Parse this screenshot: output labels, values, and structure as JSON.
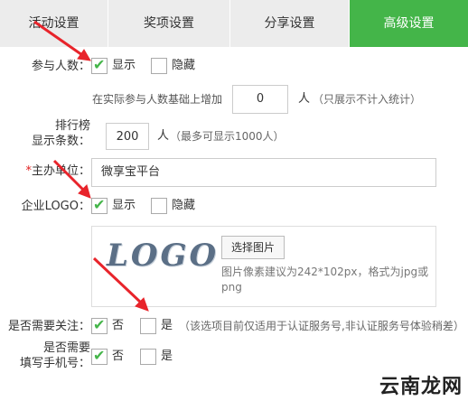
{
  "tabs": [
    {
      "label": "活动设置"
    },
    {
      "label": "奖项设置"
    },
    {
      "label": "分享设置"
    },
    {
      "label": "高级设置"
    }
  ],
  "participants": {
    "label": "参与人数：",
    "show": "显示",
    "hide": "隐藏",
    "increase_prefix": "在实际参与人数基础上增加",
    "increase_value": "0",
    "unit": "人",
    "increase_note": "（只展示不计入统计）"
  },
  "leaderboard": {
    "label_line1": "排行榜",
    "label_line2": "显示条数：",
    "value": "200",
    "unit": "人",
    "note": "（最多可显示1000人）"
  },
  "organizer": {
    "required_mark": "*",
    "label": "主办单位：",
    "value": "微享宝平台"
  },
  "logo": {
    "label": "企业LOGO：",
    "show": "显示",
    "hide": "隐藏",
    "preview_text": "LOGO",
    "pick_button": "选择图片",
    "hint": "图片像素建议为242*102px，格式为jpg或png"
  },
  "follow": {
    "label": "是否需要关注：",
    "no": "否",
    "yes": "是",
    "note": "（该选项目前仅适用于认证服务号,非认证服务号体验稍差）"
  },
  "phone": {
    "label_line1": "是否需要",
    "label_line2": "填写手机号：",
    "no": "否",
    "yes": "是"
  },
  "watermark": "云南龙网",
  "colors": {
    "accent": "#44b549",
    "arrow": "#e8242b"
  },
  "icons": {
    "check": "check-icon",
    "arrow": "red-arrow-annotation"
  }
}
